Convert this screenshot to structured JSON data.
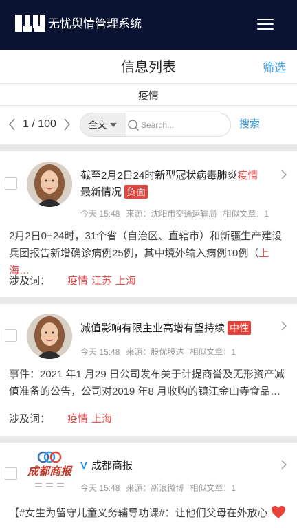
{
  "header": {
    "app_title": "无忧舆情管理系统"
  },
  "title_bar": {
    "title": "信息列表",
    "filter_label": "筛选"
  },
  "keyword": "疫情",
  "pager": {
    "page_info": "1 / 100"
  },
  "search": {
    "scope": "全文",
    "placeholder": "Search...",
    "button_label": "搜索"
  },
  "colors": {
    "topbar": "#0b1333",
    "accent": "#3a9ee6",
    "highlight": "#e34a4a",
    "tag_bg": "#e8443c",
    "verified": "#2d8ee8"
  },
  "cards": [
    {
      "headline_before": "截至2月2日24时新型冠状病毒肺炎",
      "headline_highlight": "疫情",
      "headline_after": "最新情况",
      "tag": "负面",
      "time": "今天 15:48",
      "source": "来源：沈阳市交通运输局",
      "related": "相似文章：1",
      "body_before": "2月2日0−24时，31个省（自治区、直辖市）和新疆生产建设兵团报告新增确诊病例25例，其中境外输入病例10例（",
      "body_highlight": "上海…",
      "involve_label": "涉及词：",
      "keywords": [
        "疫情",
        "江苏",
        "上海"
      ]
    },
    {
      "headline_before": "减值影响有限主业高增有望持续",
      "tag": "中性",
      "time": "今天 15:48",
      "source": "来源：股优股达",
      "related": "相似文章：1",
      "body": "事件：2021 年1 月29 日公司发布关于计提商誉及无形资产减值准备的公告，公司对2019 年8 月收购的镇江金山寺食品…",
      "involve_label": "涉及词：",
      "keywords": [
        "疫情",
        "上海"
      ]
    },
    {
      "source_name": "成都商报",
      "source_logo_text": "成都商报",
      "time": "今天 15:48",
      "source": "来源：新浪微博",
      "related": "相似文章：1",
      "body": "【#女生为留守儿童义务辅导功课#：让他们父母在外放心"
    }
  ]
}
